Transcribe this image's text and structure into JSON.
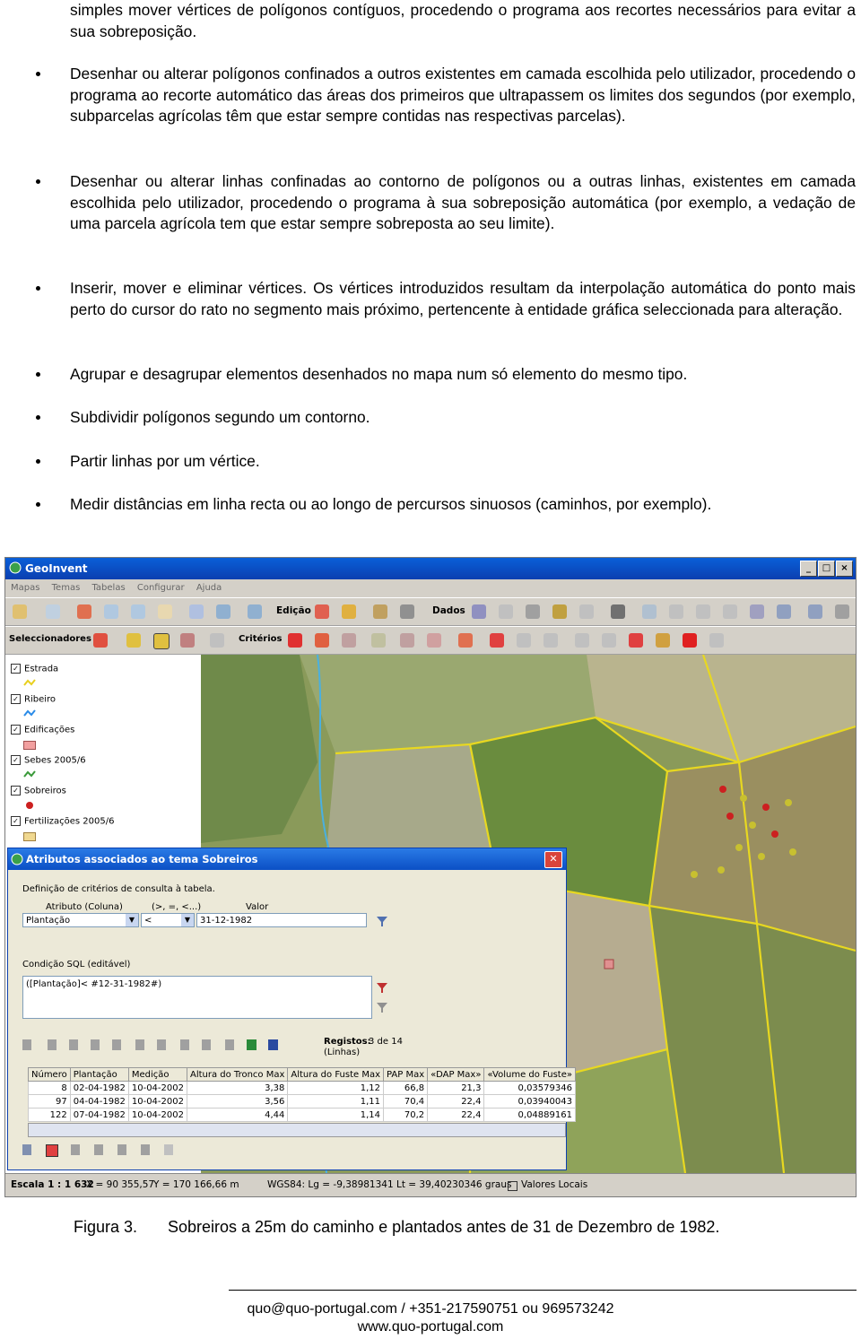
{
  "intro_text": "simples mover vértices de polígonos contíguos, procedendo o programa aos recortes necessários para evitar a sua sobreposição.",
  "bullets": [
    "Desenhar ou alterar polígonos confinados a outros existentes em camada escolhida pelo utilizador, procedendo o programa ao recorte automático das áreas dos primeiros que ultrapassem os limites dos segundos (por exemplo, subparcelas agrícolas têm que estar sempre contidas nas respectivas parcelas).",
    "Desenhar ou alterar linhas confinadas ao contorno de polígonos ou a outras linhas, existentes em camada escolhida pelo utilizador, procedendo o programa à sua sobreposição automática (por exemplo, a vedação de uma parcela agrícola tem que estar sempre sobreposta ao seu limite).",
    "Inserir, mover e eliminar vértices. Os vértices introduzidos resultam da interpolação automática do ponto mais perto do cursor do rato no segmento mais próximo, pertencente à entidade gráfica seleccionada para alteração.",
    "Agrupar e desagrupar elementos desenhados no mapa num só elemento do mesmo tipo.",
    "Subdividir polígonos segundo um contorno.",
    "Partir linhas por um vértice.",
    "Medir distâncias em linha recta ou ao longo de percursos sinuosos (caminhos, por exemplo)."
  ],
  "app": {
    "title": "GeoInvent",
    "menu": [
      "Mapas",
      "Temas",
      "Tabelas",
      "Configurar",
      "Ajuda"
    ],
    "toolbar_labels": {
      "edicao": "Edição",
      "dados": "Dados",
      "seleccionadores": "Seleccionadores",
      "criterios": "Critérios"
    },
    "legend": [
      {
        "label": "Estrada",
        "color": "#e8d020"
      },
      {
        "label": "Ribeiro",
        "color": "#2a8be8"
      },
      {
        "label": "Edificações",
        "color": "#f2a0a0"
      },
      {
        "label": "Sebes 2005/6",
        "color": "#3a9a3a"
      },
      {
        "label": "Sobreiros",
        "color": "#cc2020"
      },
      {
        "label": "Fertilizações 2005/6",
        "color": "#f0d890"
      }
    ],
    "status": {
      "escala": "Escala 1 : 1 632",
      "x": "X = 90 355,57",
      "y": "Y = 170 166,66 m",
      "wgs": "WGS84:  Lg = -9,38981341  Lt = 39,40230346 graus",
      "valores": "Valores Locais"
    }
  },
  "dialog": {
    "title": "Atributos associados ao tema Sobreiros",
    "group_label": "Definição de critérios de consulta à tabela.",
    "attr_label": "Atributo (Coluna)",
    "op_label": "(>, =, <...)",
    "value_label": "Valor",
    "attr_value": "Plantação",
    "op_value": "<",
    "value_value": "31-12-1982",
    "sql_label": "Condição SQL (editável)",
    "sql_value": "([Plantação]< #12-31-1982#)",
    "registos_label": "Registos:",
    "registos_value": "3 de 14",
    "registos_sub": "(Linhas)",
    "columns": [
      "Número",
      "Plantação",
      "Medição",
      "Altura do Tronco Max",
      "Altura do Fuste Max",
      "PAP Max",
      "«DAP Max»",
      "«Volume do Fuste»"
    ],
    "rows": [
      [
        "8",
        "02-04-1982",
        "10-04-2002",
        "3,38",
        "1,12",
        "66,8",
        "21,3",
        "0,03579346"
      ],
      [
        "97",
        "04-04-1982",
        "10-04-2002",
        "3,56",
        "1,11",
        "70,4",
        "22,4",
        "0,03940043"
      ],
      [
        "122",
        "07-04-1982",
        "10-04-2002",
        "4,44",
        "1,14",
        "70,2",
        "22,4",
        "0,04889161"
      ]
    ]
  },
  "caption": {
    "label": "Figura 3.",
    "text": "Sobreiros a 25m do caminho e plantados antes de 31 de Dezembro de 1982."
  },
  "footer": {
    "line1": "quo@quo-portugal.com / +351-217590751 ou 969573242",
    "line2": "www.quo-portugal.com"
  }
}
